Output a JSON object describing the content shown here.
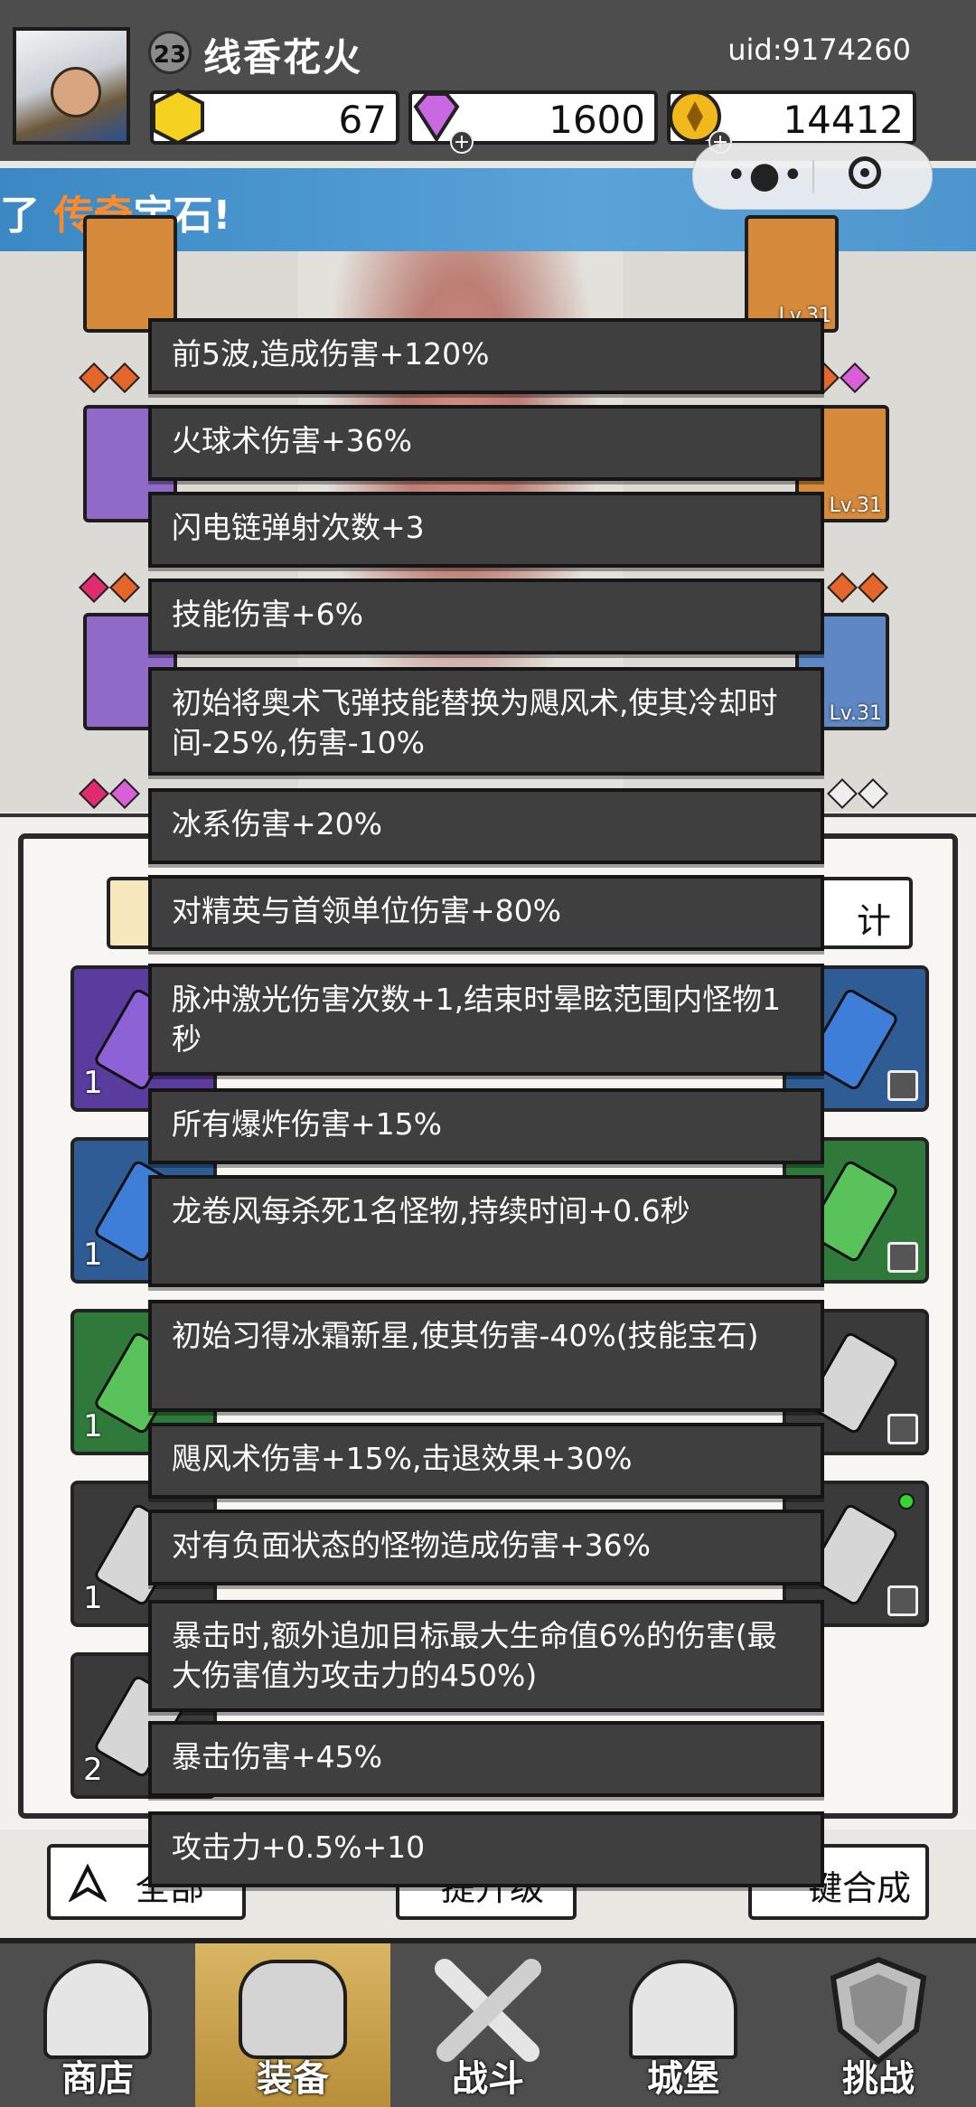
{
  "header": {
    "player_level": "23",
    "player_name": "线香花火",
    "uid": "uid:9174260",
    "resources": [
      {
        "icon": "gold-hexagon-icon",
        "value": "67",
        "color": "#f4d21f"
      },
      {
        "icon": "purple-diamond-icon",
        "value": "1600",
        "color": "#c968e0"
      },
      {
        "icon": "gold-coin-icon",
        "value": "14412",
        "color": "#f1b91c"
      }
    ]
  },
  "banner": {
    "prefix": "了",
    "highlight": "传奇",
    "suffix": "宝石!"
  },
  "mini_program": {
    "more_icon": "more-dots-icon",
    "close_icon": "target-circle-icon"
  },
  "equipment": {
    "slot_level": "Lv.31"
  },
  "inventory": {
    "right_tab_label": "计",
    "cells": [
      {
        "count": "1",
        "color": "purple"
      },
      {
        "count": "1",
        "color": "blue"
      },
      {
        "count": "1",
        "color": "green"
      },
      {
        "count": "1",
        "color": "dark"
      },
      {
        "count": "2",
        "color": "dark"
      }
    ],
    "buttons": {
      "all": "全部",
      "upgrade": "提升级",
      "merge": "键合成"
    }
  },
  "tooltip_lines": [
    "前5波,造成伤害+120%",
    "火球术伤害+36%",
    "闪电链弹射次数+3",
    "技能伤害+6%",
    "初始将奥术飞弹技能替换为飓风术,使其冷却时间-25%,伤害-10%",
    "冰系伤害+20%",
    "对精英与首领单位伤害+80%",
    "脉冲激光伤害次数+1,结束时晕眩范围内怪物1秒",
    "所有爆炸伤害+15%",
    "龙卷风每杀死1名怪物,持续时间+0.6秒",
    "初始习得冰霜新星,使其伤害-40%(技能宝石)",
    "飓风术伤害+15%,击退效果+30%",
    "对有负面状态的怪物造成伤害+36%",
    "暴击时,额外追加目标最大生命值6%的伤害(最大伤害值为攻击力的450%)",
    "暴击伤害+45%",
    "攻击力+0.5%+10"
  ],
  "nav": [
    {
      "label": "商店",
      "icon": "shop-tent-icon"
    },
    {
      "label": "装备",
      "icon": "backpack-icon",
      "active": true
    },
    {
      "label": "战斗",
      "icon": "crossed-swords-icon"
    },
    {
      "label": "城堡",
      "icon": "castle-icon"
    },
    {
      "label": "挑战",
      "icon": "shield-challenge-icon"
    }
  ]
}
